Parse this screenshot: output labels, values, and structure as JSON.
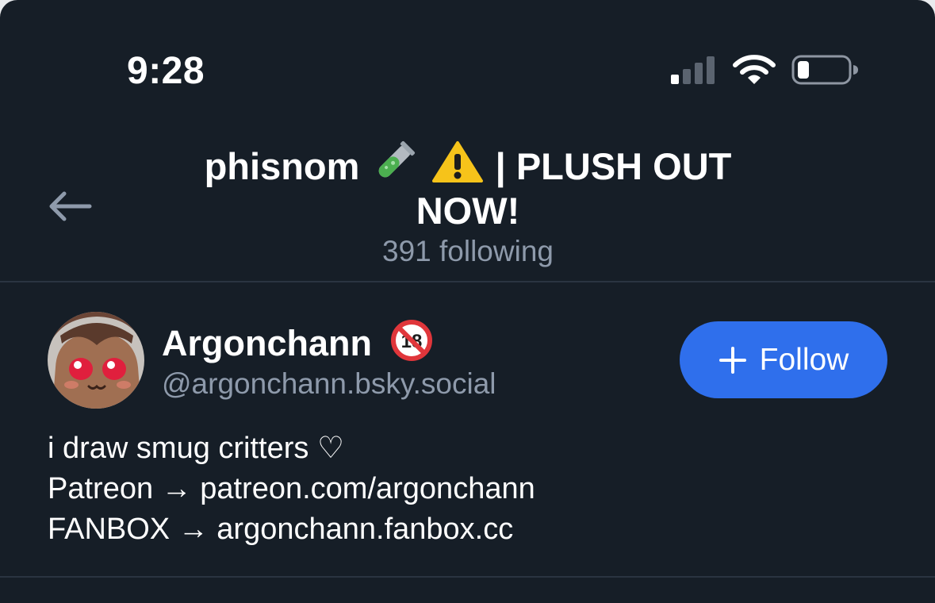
{
  "status_bar": {
    "time": "9:28",
    "icons": [
      "cellular-signal-icon",
      "wifi-icon",
      "battery-icon"
    ]
  },
  "header": {
    "back_icon": "arrow-left-icon",
    "title_name": "phisnom",
    "title_emoji": [
      "test-tube-emoji",
      "warning-emoji"
    ],
    "title_rest": "| PLUSH OUT",
    "title_line2": "NOW!",
    "subtitle": "391 following"
  },
  "profile": {
    "display_name": "Argonchann",
    "name_badge": "no-one-under-eighteen-icon",
    "handle": "@argonchann.bsky.social",
    "follow_button": {
      "label": "Follow",
      "icon": "plus-icon"
    },
    "bio": {
      "line1": "i draw smug critters ♡",
      "line2_prefix": "Patreon → ",
      "line2_link": "patreon.com/argonchann",
      "line3_prefix": "FANBOX → ",
      "line3_link": "argonchann.fanbox.cc"
    }
  },
  "colors": {
    "background": "#161e27",
    "accent": "#2f6fec",
    "muted_text": "#8e9aab",
    "divider": "#2a3441"
  }
}
